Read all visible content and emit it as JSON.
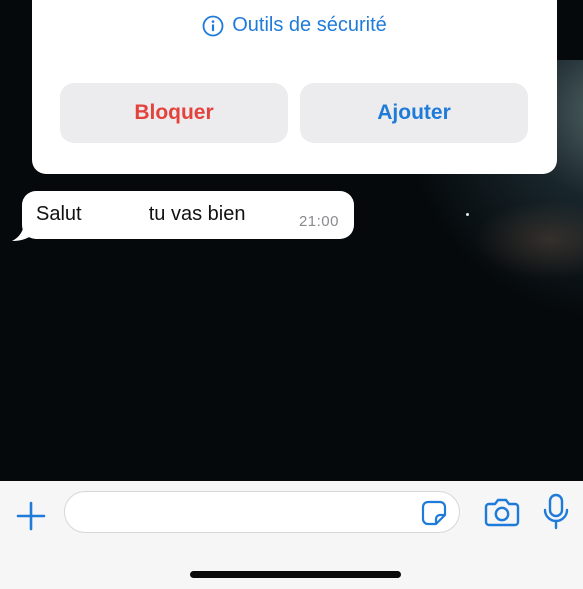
{
  "card": {
    "safety_label": "Outils de sécurité",
    "block_label": "Bloquer",
    "add_label": "Ajouter"
  },
  "message": {
    "text_before": "Salut",
    "text_after": "tu vas bien",
    "time": "21:00"
  },
  "composer": {
    "placeholder": ""
  },
  "icons": {
    "info": "info-icon",
    "plus": "plus-icon",
    "sticker": "sticker-icon",
    "camera": "camera-icon",
    "mic": "microphone-icon"
  },
  "colors": {
    "accent": "#1f7bd9",
    "danger": "#e4423d",
    "button_bg": "#ececee",
    "bar_bg": "#f6f6f6",
    "time": "#8a8a8e"
  }
}
